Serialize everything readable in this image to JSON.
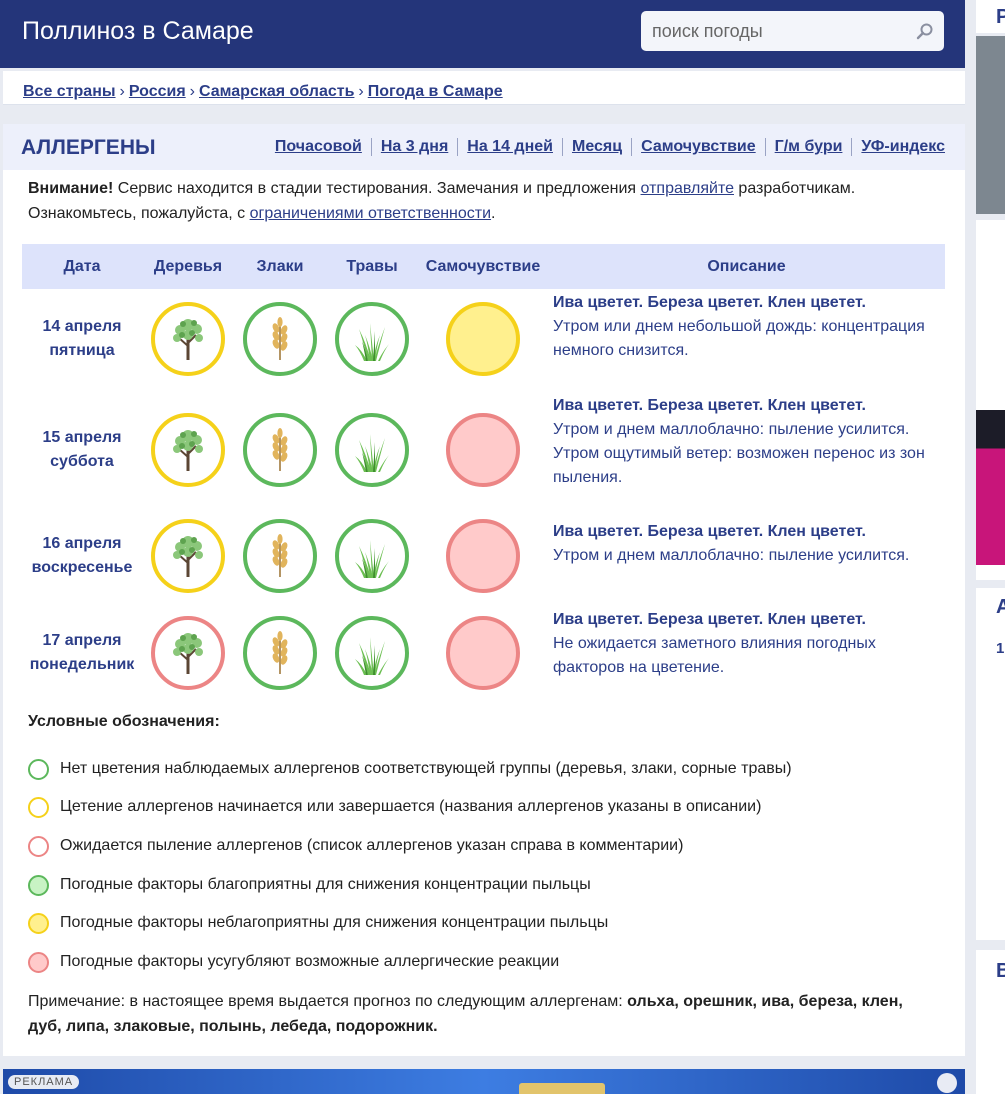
{
  "header": {
    "title": "Поллиноз в Самаре",
    "search_placeholder": "поиск погоды"
  },
  "breadcrumbs": [
    "Все страны",
    "Россия",
    "Самарская область",
    "Погода в Самаре"
  ],
  "panel": {
    "heading": "АЛЛЕРГЕНЫ",
    "tabs": [
      "Почасовой",
      "На 3 дня",
      "На 14 дней",
      "Месяц",
      "Самочувствие",
      "Г/м бури",
      "УФ-индекс"
    ]
  },
  "notice": {
    "bold": "Внимание!",
    "text1": " Сервис находится в стадии тестирования. Замечания и предложения ",
    "link1": "отправляйте",
    "text2": " разработчикам. Ознакомьтесь, пожалуйста, с ",
    "link2": "ограничениями ответственности",
    "text3": "."
  },
  "table": {
    "columns": [
      "Дата",
      "Деревья",
      "Злаки",
      "Травы",
      "Самочувствие",
      "Описание"
    ],
    "rows": [
      {
        "date": "14 апреля",
        "weekday": "пятница",
        "trees": "yellow",
        "cereals": "green",
        "grass": "green",
        "wellbeing": "yellow",
        "desc_bold": "Ива цветет. Береза цветет. Клен цветет.",
        "desc": "Утром или днем небольшой дождь: концентрация немного снизится."
      },
      {
        "date": "15 апреля",
        "weekday": "суббота",
        "trees": "yellow",
        "cereals": "green",
        "grass": "green",
        "wellbeing": "red",
        "desc_bold": "Ива цветет. Береза цветет. Клен цветет.",
        "desc": "Утром и днем маллоблачно: пыление усилится. Утром ощутимый ветер: возможен перенос из зон пыления."
      },
      {
        "date": "16 апреля",
        "weekday": "воскресенье",
        "trees": "yellow",
        "cereals": "green",
        "grass": "green",
        "wellbeing": "red",
        "desc_bold": "Ива цветет. Береза цветет. Клен цветет.",
        "desc": "Утром и днем маллоблачно: пыление усилится."
      },
      {
        "date": "17 апреля",
        "weekday": "понедельник",
        "trees": "red",
        "cereals": "green",
        "grass": "green",
        "wellbeing": "red",
        "desc_bold": "Ива цветет. Береза цветет. Клен цветет.",
        "desc": "Не ожидается заметного влияния погодных факторов на цветение."
      }
    ]
  },
  "legend": {
    "title": "Условные обозначения:",
    "items": [
      {
        "style": "ring-green",
        "text": "Нет цветения наблюдаемых аллергенов соответствующей группы (деревья, злаки, сорные травы)"
      },
      {
        "style": "ring-yellow",
        "text": "Цетение аллергенов начинается или завершается (названия аллергенов указаны в описании)"
      },
      {
        "style": "ring-red",
        "text": "Ожидается пыление аллергенов (список аллергенов указан справа в комментарии)"
      },
      {
        "style": "fill-green",
        "text": "Погодные факторы благоприятны для снижения концентрации пыльцы"
      },
      {
        "style": "fill-yellow",
        "text": "Погодные факторы неблагоприятны для снижения концентрации пыльцы"
      },
      {
        "style": "fill-red",
        "text": "Погодные факторы усугубляют возможные аллергические реакции"
      }
    ]
  },
  "note": {
    "text": "Примечание: в настоящее время выдается прогноз по следующим аллергенам: ",
    "bold": "ольха, орешник, ива, береза, клен, дуб, липа, злаковые, полынь, лебеда, подорожник."
  },
  "ad": {
    "label": "РЕКЛАМА"
  },
  "colors": {
    "header_bg": "#24357a",
    "link": "#2c3e88",
    "ring_green": "#5cb85c",
    "ring_yellow": "#f5d11a",
    "ring_red": "#ec8585",
    "fill_green": "#c8f3c4",
    "fill_yellow": "#fff08e",
    "fill_red": "#ffcaca"
  },
  "side": {
    "letters": [
      "Р",
      "А",
      "1",
      "В"
    ]
  }
}
